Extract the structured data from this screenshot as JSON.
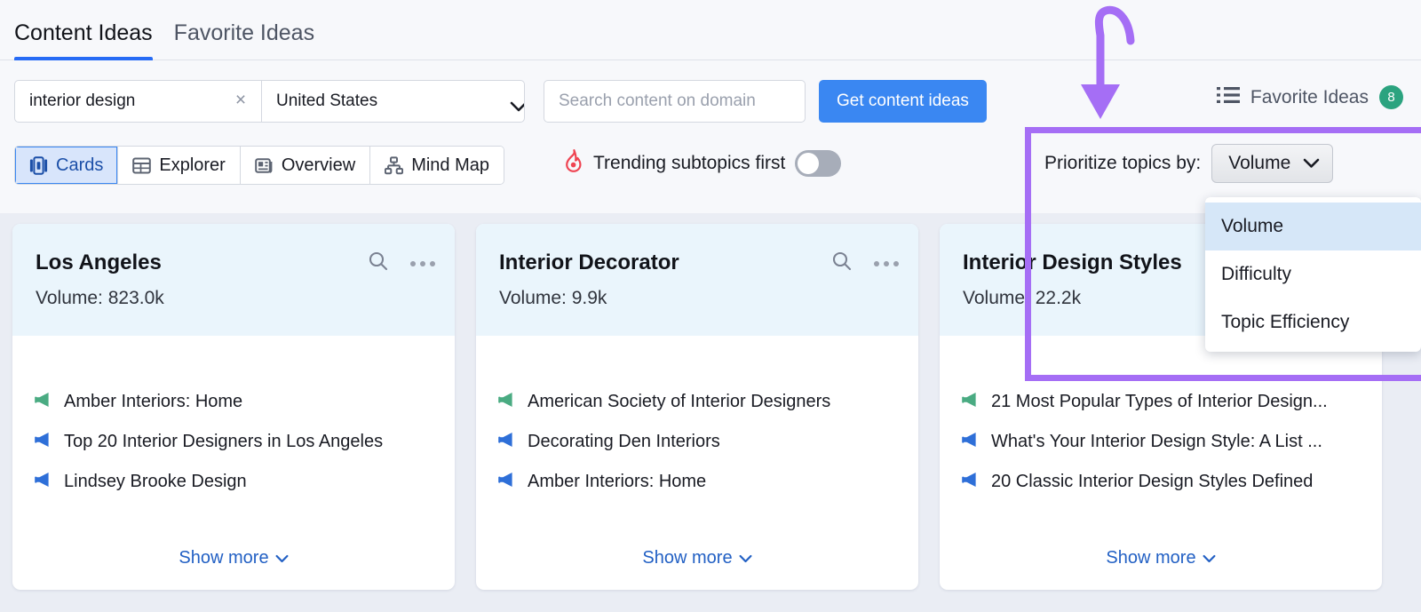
{
  "tabs": [
    {
      "label": "Content Ideas",
      "active": true
    },
    {
      "label": "Favorite Ideas",
      "active": false
    }
  ],
  "search": {
    "keyword_value": "interior design",
    "clear_glyph": "×",
    "country_value": "United States",
    "domain_placeholder": "Search content on domain",
    "cta_label": "Get content ideas"
  },
  "favorites": {
    "label": "Favorite Ideas",
    "count": "8",
    "badge_color": "#2ba37f"
  },
  "toolbar": {
    "views": [
      {
        "label": "Cards",
        "icon": "cards-icon",
        "active": true
      },
      {
        "label": "Explorer",
        "icon": "table-icon",
        "active": false
      },
      {
        "label": "Overview",
        "icon": "overview-icon",
        "active": false
      },
      {
        "label": "Mind Map",
        "icon": "mindmap-icon",
        "active": false
      }
    ],
    "trending_label": "Trending subtopics first",
    "trending_on": false,
    "flame_color": "#ef4452"
  },
  "prioritize": {
    "label": "Prioritize topics by:",
    "selected": "Volume",
    "options": [
      {
        "label": "Volume",
        "selected": true
      },
      {
        "label": "Difficulty",
        "selected": false
      },
      {
        "label": "Topic Efficiency",
        "selected": false
      }
    ],
    "highlight_color": "#a56ef5"
  },
  "cards": [
    {
      "title": "Los Angeles",
      "volume": "Volume: 823.0k",
      "items": [
        {
          "text": "Amber Interiors: Home",
          "color": "green"
        },
        {
          "text": "Top 20 Interior Designers in Los Angeles",
          "color": "blue"
        },
        {
          "text": "Lindsey Brooke Design",
          "color": "blue"
        }
      ],
      "show_more": "Show more"
    },
    {
      "title": "Interior Decorator",
      "volume": "Volume: 9.9k",
      "items": [
        {
          "text": "American Society of Interior Designers",
          "color": "green"
        },
        {
          "text": "Decorating Den Interiors",
          "color": "blue"
        },
        {
          "text": "Amber Interiors: Home",
          "color": "blue"
        }
      ],
      "show_more": "Show more"
    },
    {
      "title": "Interior Design Styles",
      "volume": "Volume: 22.2k",
      "items": [
        {
          "text": "21 Most Popular Types of Interior Design...",
          "color": "green"
        },
        {
          "text": "What's Your Interior Design Style: A List ...",
          "color": "blue"
        },
        {
          "text": "20 Classic Interior Design Styles Defined",
          "color": "blue"
        }
      ],
      "show_more": "Show more"
    }
  ],
  "colors": {
    "accent_blue": "#3a87f2",
    "link_blue": "#2260c4",
    "card_header": "#eaf5fc",
    "page_bg": "#eaedf4",
    "green_flag": "#4aab82",
    "blue_flag": "#2e6fd8"
  }
}
